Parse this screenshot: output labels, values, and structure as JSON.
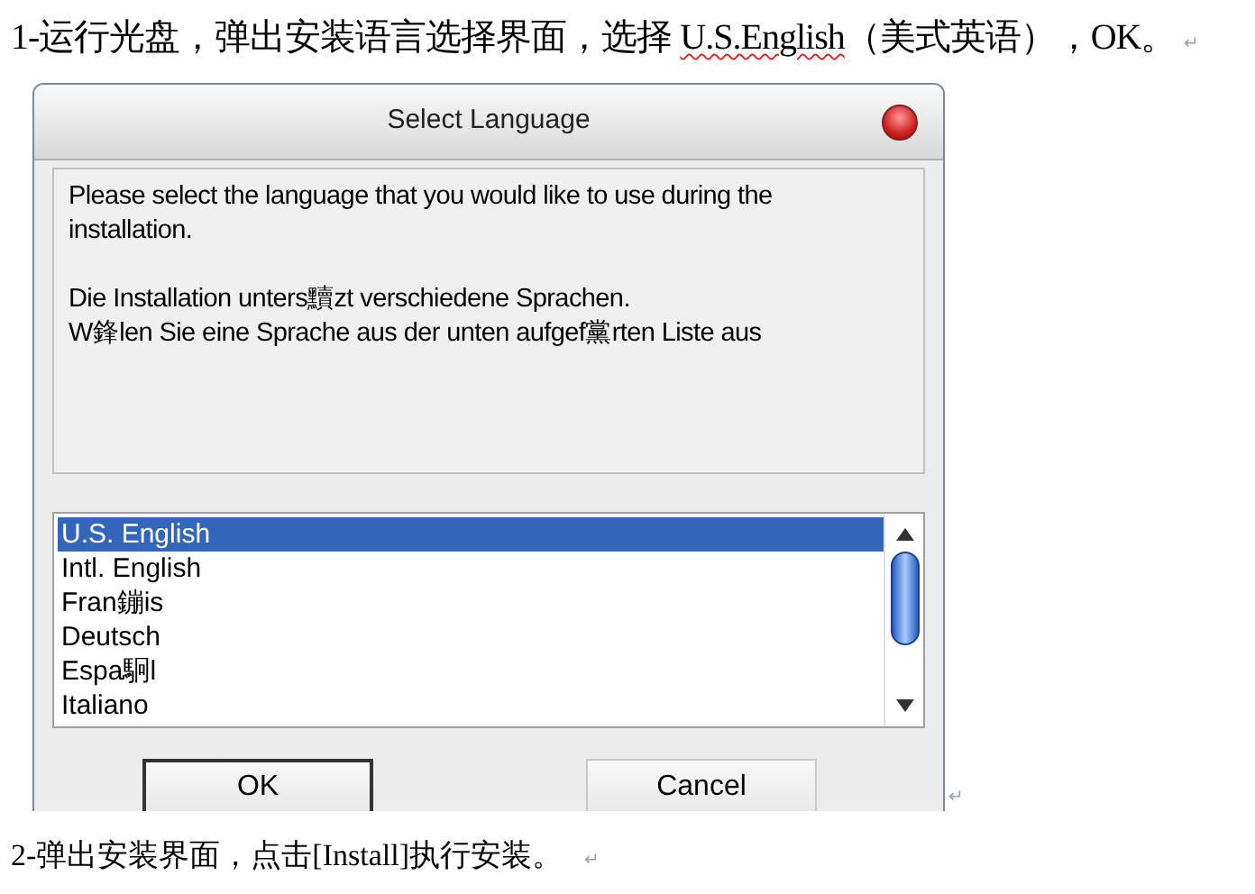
{
  "step1": {
    "before": "1-运行光盘，弹出安装语言选择界面，选择 ",
    "misspelled": "U.S.English",
    "after": "（美式英语），OK。",
    "mark": "↵"
  },
  "dialog": {
    "title": "Select Language",
    "message": [
      [
        "Please select the language that you would like to use during the installation."
      ],
      [
        "Die Installation unters黷zt verschiedene Sprachen.",
        "W鋒len Sie eine Sprache aus der unten aufgef黨rten Liste aus"
      ]
    ],
    "languages": [
      {
        "label": "U.S. English",
        "selected": true
      },
      {
        "label": "Intl. English",
        "selected": false
      },
      {
        "label": "Fran鏰is",
        "selected": false
      },
      {
        "label": "Deutsch",
        "selected": false
      },
      {
        "label": "Espa駉l",
        "selected": false
      },
      {
        "label": "Italiano",
        "selected": false
      }
    ],
    "buttons": [
      {
        "label": "OK",
        "default": true
      },
      {
        "label": "Cancel",
        "default": false
      }
    ]
  },
  "dialog_mark": "↵",
  "step2": {
    "text": "2-弹出安装界面，点击[Install]执行安装。",
    "mark": "↵"
  }
}
